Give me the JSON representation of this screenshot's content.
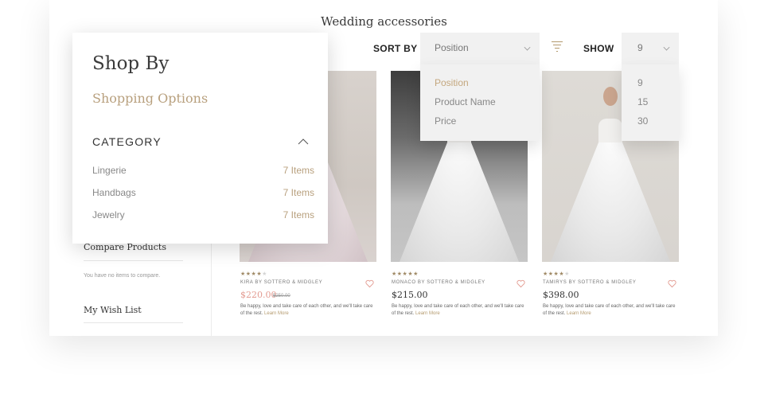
{
  "page_title": "Wedding accessories",
  "toolbar": {
    "sort_label": "SORT BY",
    "sort_selected": "Position",
    "sort_options": [
      "Position",
      "Product Name",
      "Price"
    ],
    "show_label": "SHOW",
    "show_selected": "9",
    "show_options": [
      "9",
      "15",
      "30"
    ]
  },
  "panel": {
    "title": "Shop By",
    "subtitle": "Shopping Options",
    "category_heading": "CATEGORY",
    "categories": [
      {
        "label": "Lingerie",
        "count": "7 Items"
      },
      {
        "label": "Handbags",
        "count": "7 Items"
      },
      {
        "label": "Jewelry",
        "count": "7 Items"
      }
    ]
  },
  "sidebar": {
    "compare_heading": "Compare Products",
    "compare_note": "You have no items to compare.",
    "wishlist_heading": "My Wish List"
  },
  "products": [
    {
      "name": "KIRA BY SOTTERO & MIDGLEY",
      "price": "$220.00",
      "old_price": "$250.00",
      "on_sale": true,
      "rating": 3.5,
      "desc": "Be happy, love and take care of each other, and we'll take care of the rest.",
      "more": "Learn More"
    },
    {
      "name": "MONACO BY SOTTERO & MIDGLEY",
      "price": "$215.00",
      "old_price": "",
      "on_sale": false,
      "rating": 4.5,
      "desc": "Be happy, love and take care of each other, and we'll take care of the rest.",
      "more": "Learn More"
    },
    {
      "name": "TAMIRYS BY SOTTERO & MIDGLEY",
      "price": "$398.00",
      "old_price": "",
      "on_sale": false,
      "rating": 3.5,
      "desc": "Be happy, love and take care of each other, and we'll take care of the rest.",
      "more": "Learn More"
    }
  ],
  "colors": {
    "accent": "#b8a07e",
    "sale": "#e39b91",
    "heart": "#e39b91"
  }
}
